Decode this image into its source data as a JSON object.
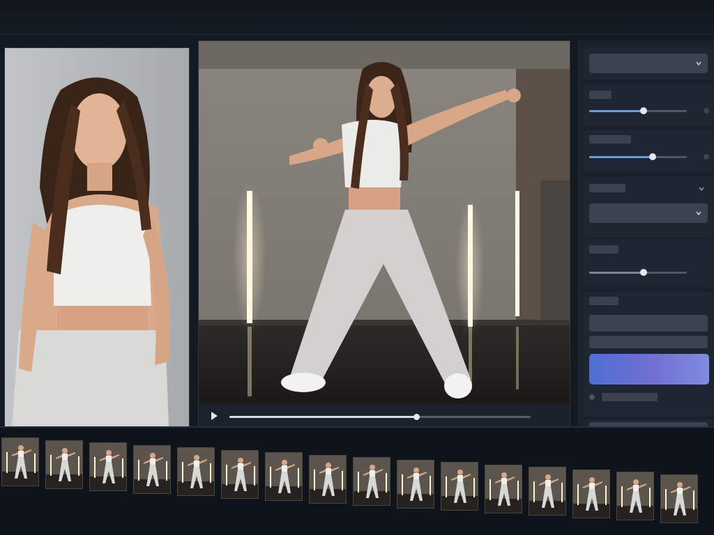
{
  "app": {
    "name": "",
    "accent": "#6f9be6",
    "generate_gradient": [
      "#4f6fd4",
      "#7f8be0"
    ]
  },
  "reference": {
    "caption": ""
  },
  "preview": {
    "playback": {
      "progress": 0.62,
      "play_icon": "play-icon",
      "favorite_icon": "star-icon"
    }
  },
  "settings": {
    "sliders": [
      {
        "id": "slider-1",
        "value": 0.56
      },
      {
        "id": "slider-2",
        "value": 0.65
      },
      {
        "id": "slider-3",
        "value": 0.56
      }
    ],
    "dropdowns": [
      "",
      "",
      "",
      "",
      ""
    ],
    "generate_label": ""
  },
  "filmstrip": {
    "frame_count": 16,
    "selected_frame": 0
  }
}
